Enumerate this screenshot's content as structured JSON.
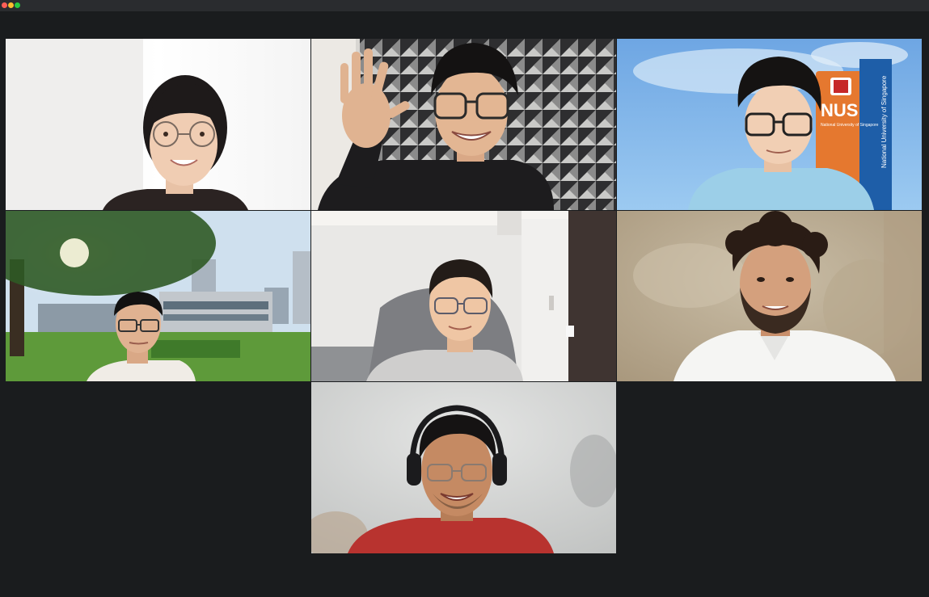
{
  "window": {
    "controls": {
      "close_color": "#ff5f57",
      "minimize_color": "#febc2e",
      "maximize_color": "#28c840"
    }
  },
  "meeting": {
    "active_speaker_color": "#23d959",
    "tiles": [
      {
        "id": "p1",
        "background": "white-wall",
        "shirt": "black",
        "glasses": true
      },
      {
        "id": "p2",
        "background": "geometric-tile-wall",
        "shirt": "black",
        "glasses": true,
        "waving": true,
        "active_speaker": true
      },
      {
        "id": "p3",
        "background": "nus-campus-virtual",
        "shirt": "light-blue",
        "glasses": true
      },
      {
        "id": "p4",
        "background": "campus-lawn-virtual",
        "shirt": "white",
        "glasses": true
      },
      {
        "id": "p5",
        "background": "bedroom-wall",
        "shirt": "grey",
        "glasses": true
      },
      {
        "id": "p6",
        "background": "textured-beige-wall",
        "shirt": "white-collar",
        "glasses": false
      },
      {
        "id": "p7",
        "background": "grey-wall",
        "shirt": "red",
        "glasses": true,
        "headphones": true
      }
    ],
    "nus_sign": {
      "logo_text": "NUS",
      "small_text": "National University of Singapore",
      "vertical_text": "National University of Singapore"
    }
  }
}
